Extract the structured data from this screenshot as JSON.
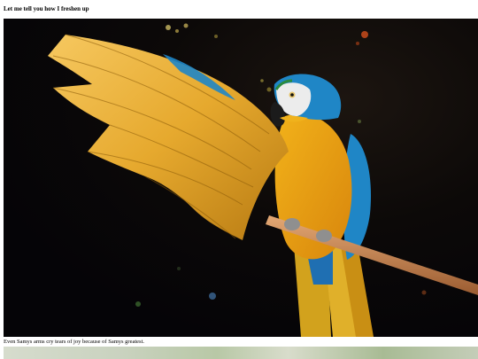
{
  "post": {
    "heading": "Let me tell you how I freshen up",
    "caption": "Even Samys arms cry tears of joy because of Samys greatest."
  },
  "images": {
    "main_photo": "parrot-photo",
    "next_photo": "next-photo"
  },
  "colors": {
    "photo_background": "#08060a",
    "parrot_yellow": "#e8a415",
    "parrot_blue": "#1f86c6",
    "perch": "#c98a55"
  }
}
